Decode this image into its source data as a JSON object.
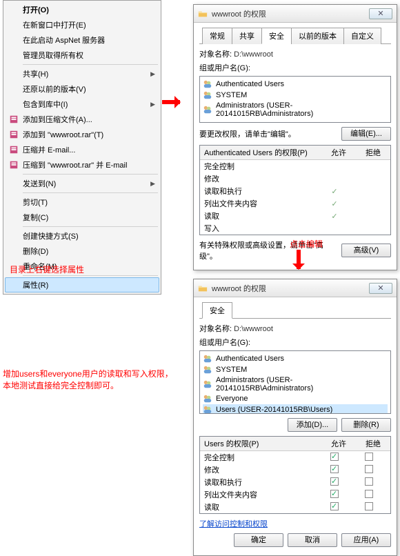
{
  "context_menu": {
    "items": [
      {
        "label": "打开(O)",
        "sep": false,
        "sub": false,
        "bold": true
      },
      {
        "label": "在新窗口中打开(E)",
        "sep": false,
        "sub": false
      },
      {
        "label": "在此启动 AspNet 服务器",
        "sep": false,
        "sub": false
      },
      {
        "label": "管理员取得所有权",
        "sep": false,
        "sub": false
      },
      {
        "sep": true
      },
      {
        "label": "共享(H)",
        "sub": true
      },
      {
        "label": "还原以前的版本(V)",
        "sub": false
      },
      {
        "label": "包含到库中(I)",
        "sub": true
      },
      {
        "label": "添加到压缩文件(A)...",
        "sub": false,
        "icon": "rar"
      },
      {
        "label": "添加到 \"wwwroot.rar\"(T)",
        "sub": false,
        "icon": "rar"
      },
      {
        "label": "压缩并 E-mail...",
        "sub": false,
        "icon": "rar"
      },
      {
        "label": "压缩到 \"wwwroot.rar\" 并 E-mail",
        "sub": false,
        "icon": "rar"
      },
      {
        "sep": true
      },
      {
        "label": "发送到(N)",
        "sub": true
      },
      {
        "sep": true
      },
      {
        "label": "剪切(T)",
        "sub": false
      },
      {
        "label": "复制(C)",
        "sub": false
      },
      {
        "sep": true
      },
      {
        "label": "创建快捷方式(S)",
        "sub": false
      },
      {
        "label": "删除(D)",
        "sub": false
      },
      {
        "label": "重命名(M)",
        "sub": false
      },
      {
        "sep": true
      },
      {
        "label": "属性(R)",
        "sub": false,
        "highlight": true
      }
    ]
  },
  "caption1": "目录上右键选择属性",
  "caption2": "点击编辑",
  "caption3": "增加users和everyone用户的读取和写入权限，本地测试直接给完全控制即可。",
  "dialog1": {
    "title": "wwwroot 的权限",
    "tabs": [
      "常规",
      "共享",
      "安全",
      "以前的版本",
      "自定义"
    ],
    "active_tab": 2,
    "object_label": "对象名称:",
    "object_path": "D:\\wwwroot",
    "groups_label": "组或用户名(G):",
    "users": [
      "Authenticated Users",
      "SYSTEM",
      "Administrators (USER-20141015RB\\Administrators)"
    ],
    "edit_hint": "要更改权限，请单击\"编辑\"。",
    "edit_btn": "编辑(E)...",
    "perm_label": "Authenticated Users 的权限(P)",
    "col_allow": "允许",
    "col_deny": "拒绝",
    "perms": [
      "完全控制",
      "修改",
      "读取和执行",
      "列出文件夹内容",
      "读取",
      "写入"
    ],
    "allow_checks": [
      false,
      false,
      true,
      true,
      true,
      false
    ],
    "advanced_hint": "有关特殊权限或高级设置，请单击\"高级\"。",
    "advanced_btn": "高级(V)"
  },
  "dialog2": {
    "title": "wwwroot 的权限",
    "tabs": [
      "安全"
    ],
    "object_label": "对象名称:",
    "object_path": "D:\\wwwroot",
    "groups_label": "组或用户名(G):",
    "users": [
      "Authenticated Users",
      "SYSTEM",
      "Administrators (USER-20141015RB\\Administrators)",
      "Everyone",
      "Users (USER-20141015RB\\Users)"
    ],
    "add_btn": "添加(D)...",
    "remove_btn": "删除(R)",
    "perm_label": "Users 的权限(P)",
    "col_allow": "允许",
    "col_deny": "拒绝",
    "perms": [
      "完全控制",
      "修改",
      "读取和执行",
      "列出文件夹内容",
      "读取"
    ],
    "allow_checks": [
      true,
      true,
      true,
      true,
      true
    ],
    "link": "了解访问控制和权限",
    "ok": "确定",
    "cancel": "取消",
    "apply": "应用(A)"
  }
}
